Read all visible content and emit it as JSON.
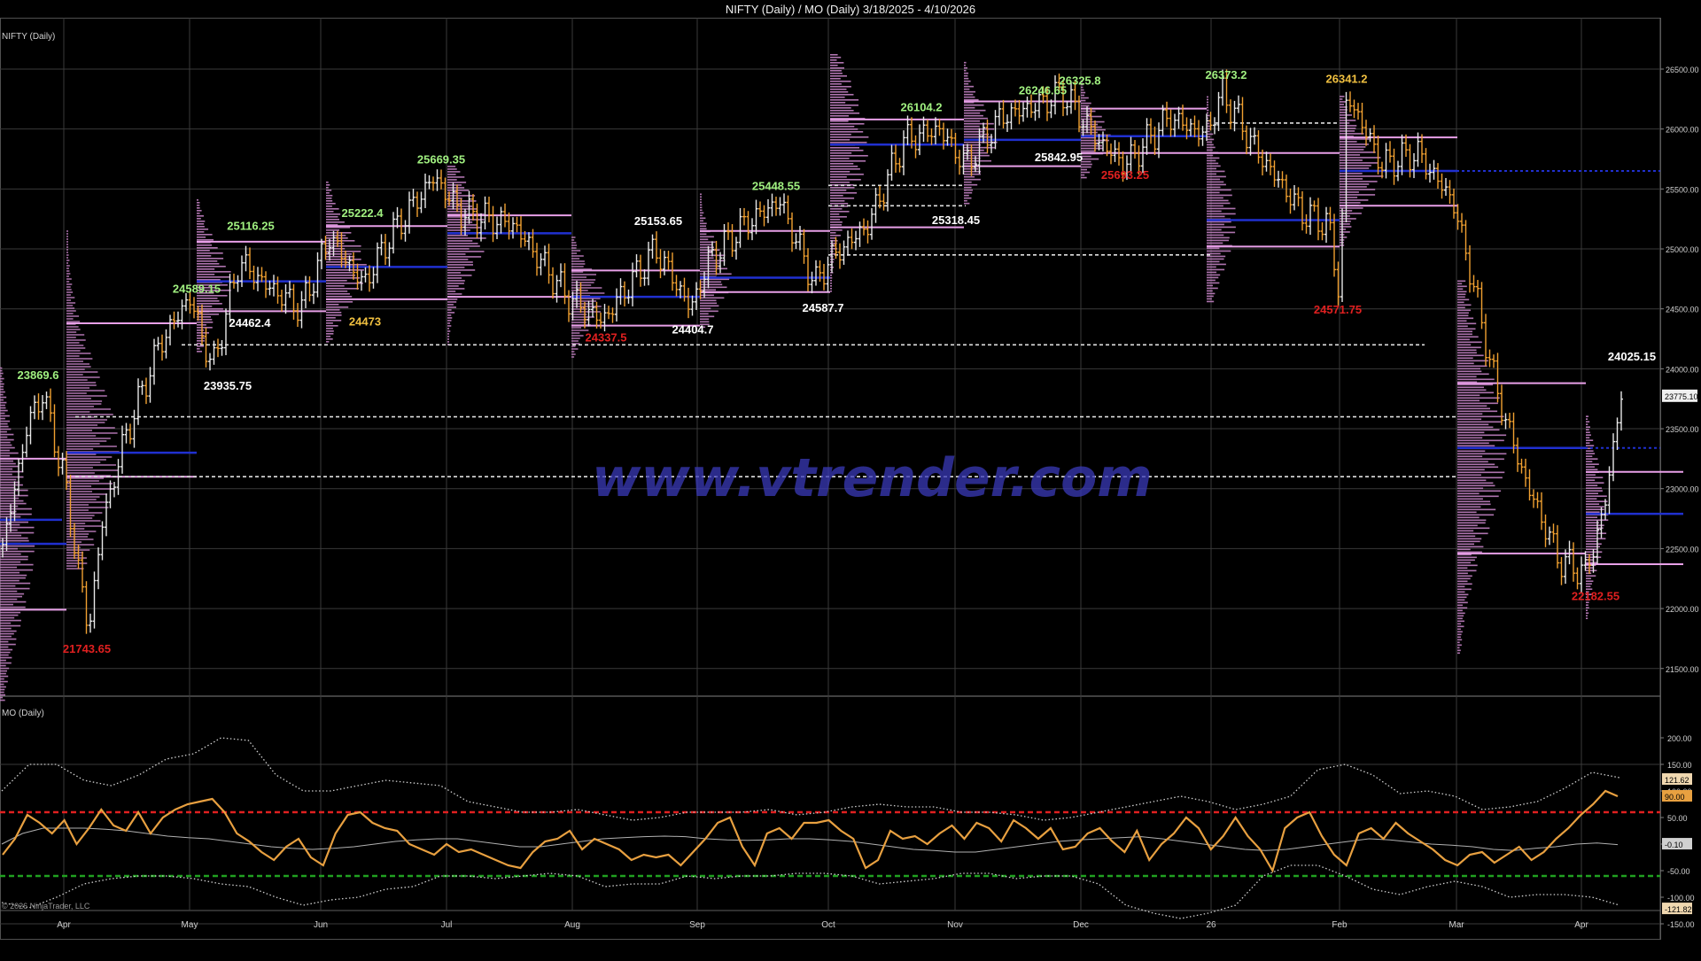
{
  "window": {
    "title": "NIFTY (Daily) / MO (Daily)  3/18/2025 - 4/10/2026",
    "price_panel_label": "NIFTY (Daily)",
    "indicator_panel_label": "MO (Daily)",
    "copyright": "© 2026 NinjaTrader, LLC",
    "watermark": "www.vtrender.com"
  },
  "colors": {
    "background": "#000000",
    "grid": "#3a3a3a",
    "up_bar": "#e8e8e8",
    "down_bar": "#f0a030",
    "profile": "#c080c0",
    "poc_line": "#2030d0",
    "vah_val_line": "#e8a0e8",
    "dashed_level": "#e0e0e0",
    "label_high": "#a0f080",
    "label_low_white": "#ffffff",
    "label_low_red": "#e02020",
    "label_yellow": "#f0c040",
    "mo_line": "#e8a040",
    "mo_avg": "#b0b0b0",
    "mo_bands": "#d0d0d0",
    "mo_upper_level": "#e02020",
    "mo_lower_level": "#20a020"
  },
  "chart_data": [
    {
      "type": "candlestick",
      "title": "NIFTY (Daily)",
      "x_tick_labels": [
        "Apr",
        "May",
        "Jun",
        "Jul",
        "Aug",
        "Sep",
        "Oct",
        "Nov",
        "Dec",
        "26",
        "Feb",
        "Mar",
        "Apr"
      ],
      "y_tick_labels": [
        "26500.00",
        "26000.00",
        "25500.00",
        "25000.00",
        "24500.00",
        "24000.00",
        "23500.00",
        "23000.00",
        "22500.00",
        "22000.00",
        "21500.00"
      ],
      "ylim": [
        21300,
        26750
      ],
      "last_price_label": "23775.10",
      "annotations": [
        {
          "text": "23869.6",
          "kind": "high",
          "value": 23869.6
        },
        {
          "text": "21743.65",
          "kind": "low_red",
          "value": 21743.65
        },
        {
          "text": "24589.15",
          "kind": "high",
          "value": 24589.15
        },
        {
          "text": "23935.75",
          "kind": "low",
          "value": 23935.75
        },
        {
          "text": "25116.25",
          "kind": "high",
          "value": 25116.25
        },
        {
          "text": "24462.4",
          "kind": "low",
          "value": 24462.4
        },
        {
          "text": "25222.4",
          "kind": "high",
          "value": 25222.4
        },
        {
          "text": "24473",
          "kind": "low_yellow",
          "value": 24473
        },
        {
          "text": "25669.35",
          "kind": "high",
          "value": 25669.35
        },
        {
          "text": "24337.5",
          "kind": "low_red",
          "value": 24337.5
        },
        {
          "text": "25153.65",
          "kind": "high_white",
          "value": 25153.65
        },
        {
          "text": "24404.7",
          "kind": "low",
          "value": 24404.7
        },
        {
          "text": "25448.55",
          "kind": "high",
          "value": 25448.55
        },
        {
          "text": "24587.7",
          "kind": "low",
          "value": 24587.7
        },
        {
          "text": "26104.2",
          "kind": "high",
          "value": 26104.2
        },
        {
          "text": "25318.45",
          "kind": "low",
          "value": 25318.45
        },
        {
          "text": "26246.65",
          "kind": "high",
          "value": 26246.65
        },
        {
          "text": "26325.8",
          "kind": "high",
          "value": 26325.8
        },
        {
          "text": "25842.95",
          "kind": "low",
          "value": 25842.95
        },
        {
          "text": "25693.25",
          "kind": "low_red",
          "value": 25693.25
        },
        {
          "text": "26373.2",
          "kind": "high",
          "value": 26373.2
        },
        {
          "text": "26341.2",
          "kind": "high_yellow",
          "value": 26341.2
        },
        {
          "text": "24571.75",
          "kind": "low_red",
          "value": 24571.75
        },
        {
          "text": "24025.15",
          "kind": "high_white",
          "value": 24025.15
        },
        {
          "text": "22182.55",
          "kind": "low_red",
          "value": 22182.55
        }
      ],
      "monthly_profiles": [
        {
          "month": "Mar 2025",
          "poc": 22540,
          "vah": 23250,
          "val": 21990
        },
        {
          "month": "Apr",
          "poc": 23300,
          "vah": 24380,
          "val": 23100
        },
        {
          "month": "May",
          "poc": 24730,
          "vah": 25060,
          "val": 24480
        },
        {
          "month": "Jun",
          "poc": 24850,
          "vah": 25190,
          "val": 24580
        },
        {
          "month": "Jul",
          "poc": 25130,
          "vah": 25280,
          "val": 24600
        },
        {
          "month": "Aug",
          "poc": 24600,
          "vah": 24820,
          "val": 24360
        },
        {
          "month": "Sep",
          "poc": 24760,
          "vah": 25150,
          "val": 24640
        },
        {
          "month": "Oct",
          "poc": 25870,
          "vah": 26080,
          "val": 25180
        },
        {
          "month": "Nov",
          "poc": 25910,
          "vah": 26230,
          "val": 25690
        },
        {
          "month": "Dec",
          "poc": 25940,
          "vah": 26170,
          "val": 25800
        },
        {
          "month": "Jan 2026",
          "poc": 25240,
          "vah": 25800,
          "val": 25020
        },
        {
          "month": "Feb",
          "poc": 25650,
          "vah": 25930,
          "val": 25360
        },
        {
          "month": "Mar",
          "poc": 23340,
          "vah": 23880,
          "val": 22460
        },
        {
          "month": "Apr 2026",
          "poc": 22790,
          "vah": 23140,
          "val": 22370
        }
      ],
      "dashed_levels": [
        24200,
        23600,
        23100,
        25530,
        25360,
        24950,
        26050
      ]
    },
    {
      "type": "line",
      "title": "MO (Daily)",
      "y_tick_labels": [
        "200.00",
        "150.00",
        "100.00",
        "50.00",
        "0.00",
        "-50.00",
        "-100.00",
        "-150.00"
      ],
      "ylim": [
        -160,
        210
      ],
      "value_labels": [
        "121.62",
        "90.00",
        "-0.10",
        "-121.82"
      ],
      "levels": [
        {
          "value": 60,
          "color": "red"
        },
        {
          "value": -60,
          "color": "green"
        }
      ],
      "series": [
        {
          "name": "MO",
          "values": [
            -20,
            10,
            55,
            40,
            20,
            45,
            0,
            30,
            65,
            35,
            25,
            60,
            20,
            50,
            65,
            75,
            80,
            85,
            60,
            20,
            5,
            -15,
            -30,
            -5,
            10,
            -25,
            -40,
            20,
            55,
            60,
            40,
            30,
            25,
            0,
            -10,
            -20,
            0,
            -15,
            -10,
            -20,
            -30,
            -40,
            -45,
            -15,
            5,
            10,
            25,
            -10,
            10,
            0,
            -10,
            -30,
            -20,
            -25,
            -20,
            -40,
            -15,
            10,
            40,
            50,
            -5,
            -40,
            20,
            30,
            10,
            40,
            40,
            45,
            25,
            10,
            -45,
            -30,
            25,
            10,
            15,
            0,
            20,
            35,
            10,
            40,
            30,
            5,
            45,
            30,
            10,
            30,
            -10,
            -5,
            20,
            30,
            5,
            -15,
            25,
            -30,
            0,
            20,
            50,
            30,
            -10,
            15,
            50,
            15,
            -10,
            -50,
            30,
            50,
            60,
            15,
            -20,
            -40,
            20,
            30,
            10,
            40,
            20,
            5,
            -10,
            -30,
            -40,
            -20,
            -15,
            -35,
            -20,
            -5,
            -30,
            -15,
            10,
            30,
            55,
            75,
            100,
            90
          ]
        },
        {
          "name": "MO avg",
          "values": [
            0,
            20,
            30,
            30,
            30,
            28,
            25,
            20,
            15,
            12,
            10,
            5,
            0,
            -5,
            -8,
            -10,
            -8,
            -5,
            0,
            5,
            8,
            10,
            10,
            5,
            0,
            -5,
            -5,
            0,
            5,
            10,
            12,
            14,
            15,
            14,
            10,
            8,
            7,
            8,
            10,
            10,
            8,
            5,
            0,
            -5,
            -10,
            -12,
            -15,
            -15,
            -10,
            -5,
            0,
            5,
            8,
            10,
            12,
            14,
            10,
            5,
            0,
            -5,
            -10,
            -12,
            -10,
            -5,
            0,
            5,
            10,
            8,
            4,
            0,
            -2,
            -5,
            -10,
            -12,
            -8,
            -5,
            0,
            2,
            -1
          ]
        },
        {
          "name": "Upper band",
          "values": [
            100,
            150,
            150,
            120,
            110,
            130,
            160,
            170,
            200,
            195,
            130,
            100,
            100,
            110,
            120,
            115,
            110,
            80,
            70,
            60,
            60,
            65,
            55,
            45,
            50,
            60,
            60,
            60,
            65,
            55,
            60,
            70,
            75,
            70,
            70,
            60,
            60,
            55,
            45,
            50,
            60,
            70,
            80,
            90,
            80,
            65,
            75,
            90,
            140,
            150,
            130,
            95,
            100,
            90,
            65,
            70,
            80,
            105,
            135,
            125
          ]
        },
        {
          "name": "Lower band",
          "values": [
            -110,
            -120,
            -100,
            -75,
            -65,
            -60,
            -60,
            -65,
            -75,
            -80,
            -100,
            -115,
            -105,
            -100,
            -85,
            -80,
            -60,
            -60,
            -65,
            -60,
            -55,
            -60,
            -80,
            -75,
            -75,
            -60,
            -65,
            -60,
            -60,
            -55,
            -55,
            -60,
            -75,
            -70,
            -65,
            -55,
            -55,
            -65,
            -60,
            -60,
            -75,
            -115,
            -130,
            -140,
            -130,
            -115,
            -60,
            -40,
            -40,
            -60,
            -85,
            -95,
            -80,
            -70,
            -80,
            -100,
            -95,
            -95,
            -100,
            -115
          ]
        }
      ]
    }
  ]
}
